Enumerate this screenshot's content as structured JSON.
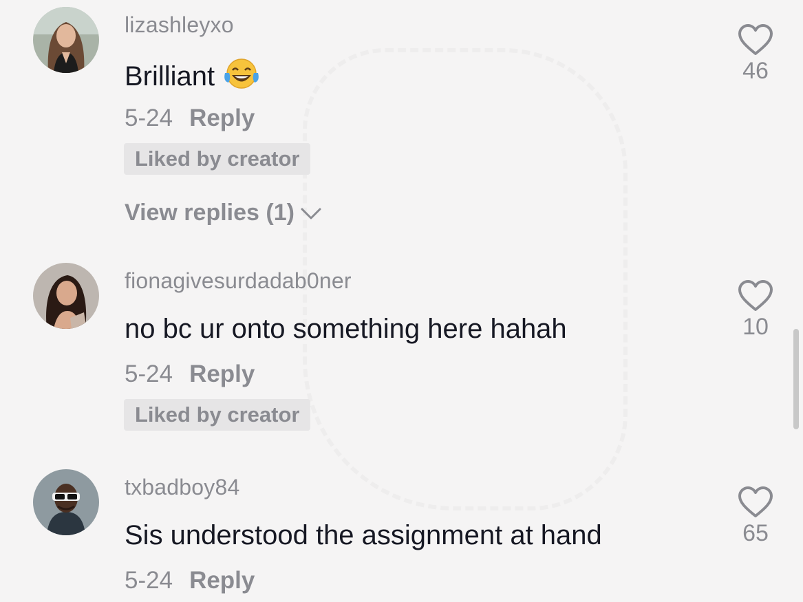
{
  "comments": [
    {
      "username": "lizashleyxo",
      "text": "Brilliant",
      "emoji": "face-with-tears-of-joy",
      "date": "5-24",
      "reply_label": "Reply",
      "badge": "Liked by creator",
      "view_replies": "View replies (1)",
      "likes": "46"
    },
    {
      "username": "fionagivesurdadab0ner",
      "text": "no bc ur onto something here hahah",
      "date": "5-24",
      "reply_label": "Reply",
      "badge": "Liked by creator",
      "likes": "10"
    },
    {
      "username": "txbadboy84",
      "text": "Sis understood the assignment at hand",
      "date": "5-24",
      "reply_label": "Reply",
      "likes": "65"
    }
  ],
  "colors": {
    "background": "#f5f4f4",
    "primary_text": "#161823",
    "secondary_text": "#8a8b91",
    "badge_bg": "#e6e5e6"
  },
  "icons": [
    "heart-outline-icon",
    "chevron-down-icon",
    "face-with-tears-of-joy-emoji"
  ]
}
